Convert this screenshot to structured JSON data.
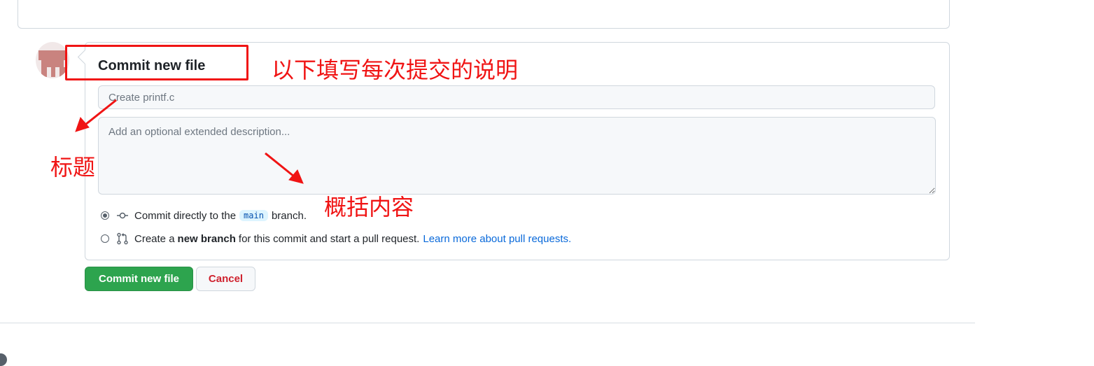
{
  "commit_form": {
    "heading": "Commit new file",
    "summary_placeholder": "Create printf.c",
    "description_placeholder": "Add an optional extended description...",
    "option_direct": {
      "text_before": "Commit directly to the",
      "branch": "main",
      "text_after": "branch.",
      "selected": true
    },
    "option_new_branch": {
      "text_before": "Create a",
      "bold": "new branch",
      "text_after": "for this commit and start a pull request.",
      "link": "Learn more about pull requests.",
      "selected": false
    },
    "commit_button": "Commit new file",
    "cancel_button": "Cancel"
  },
  "annotations": {
    "heading_note": "以下填写每次提交的说明",
    "title_note": "标题",
    "content_note": "概括内容",
    "color": "#f01414"
  },
  "colors": {
    "commit_green": "#2da44e",
    "cancel_red": "#cf222e",
    "link_blue": "#0969da"
  }
}
